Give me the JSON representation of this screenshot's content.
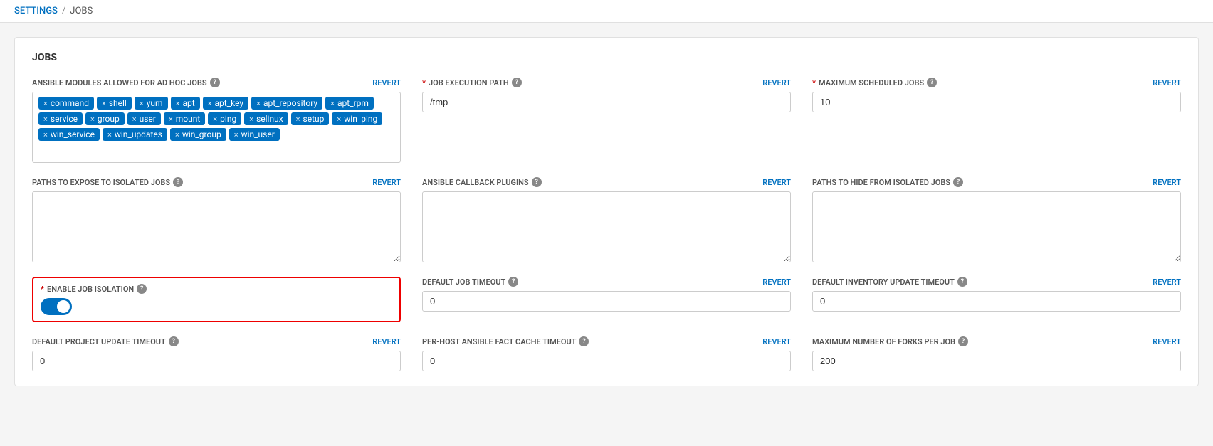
{
  "breadcrumb": {
    "settings_label": "SETTINGS",
    "separator": "/",
    "current_label": "JOBS"
  },
  "card": {
    "title": "JOBS"
  },
  "fields": {
    "ansible_modules": {
      "label": "ANSIBLE MODULES ALLOWED FOR AD HOC JOBS",
      "required": false,
      "revert": "REVERT",
      "tags": [
        "command",
        "shell",
        "yum",
        "apt",
        "apt_key",
        "apt_repository",
        "apt_rpm",
        "service",
        "group",
        "user",
        "mount",
        "ping",
        "selinux",
        "setup",
        "win_ping",
        "win_service",
        "win_updates",
        "win_group",
        "win_user"
      ]
    },
    "job_execution_path": {
      "label": "JOB EXECUTION PATH",
      "required": true,
      "revert": "REVERT",
      "value": "/tmp",
      "placeholder": ""
    },
    "maximum_scheduled_jobs": {
      "label": "MAXIMUM SCHEDULED JOBS",
      "required": true,
      "revert": "REVERT",
      "value": "10"
    },
    "paths_expose": {
      "label": "PATHS TO EXPOSE TO ISOLATED JOBS",
      "required": false,
      "revert": "REVERT",
      "value": ""
    },
    "ansible_callback": {
      "label": "ANSIBLE CALLBACK PLUGINS",
      "required": false,
      "revert": "REVERT",
      "value": ""
    },
    "paths_hide": {
      "label": "PATHS TO HIDE FROM ISOLATED JOBS",
      "required": false,
      "revert": "REVERT",
      "value": ""
    },
    "enable_job_isolation": {
      "label": "ENABLE JOB ISOLATION",
      "required": true,
      "enabled": true
    },
    "default_job_timeout": {
      "label": "DEFAULT JOB TIMEOUT",
      "required": false,
      "revert": "REVERT",
      "value": "0"
    },
    "default_inventory_update_timeout": {
      "label": "DEFAULT INVENTORY UPDATE TIMEOUT",
      "required": false,
      "revert": "REVERT",
      "value": "0"
    },
    "default_project_update_timeout": {
      "label": "DEFAULT PROJECT UPDATE TIMEOUT",
      "required": false,
      "revert": "REVERT",
      "value": "0"
    },
    "per_host_fact_cache_timeout": {
      "label": "PER-HOST ANSIBLE FACT CACHE TIMEOUT",
      "required": false,
      "revert": "REVERT",
      "value": "0"
    },
    "maximum_forks": {
      "label": "MAXIMUM NUMBER OF FORKS PER JOB",
      "required": false,
      "revert": "REVERT",
      "value": "200"
    }
  },
  "icons": {
    "help": "?",
    "tag_remove": "×"
  }
}
